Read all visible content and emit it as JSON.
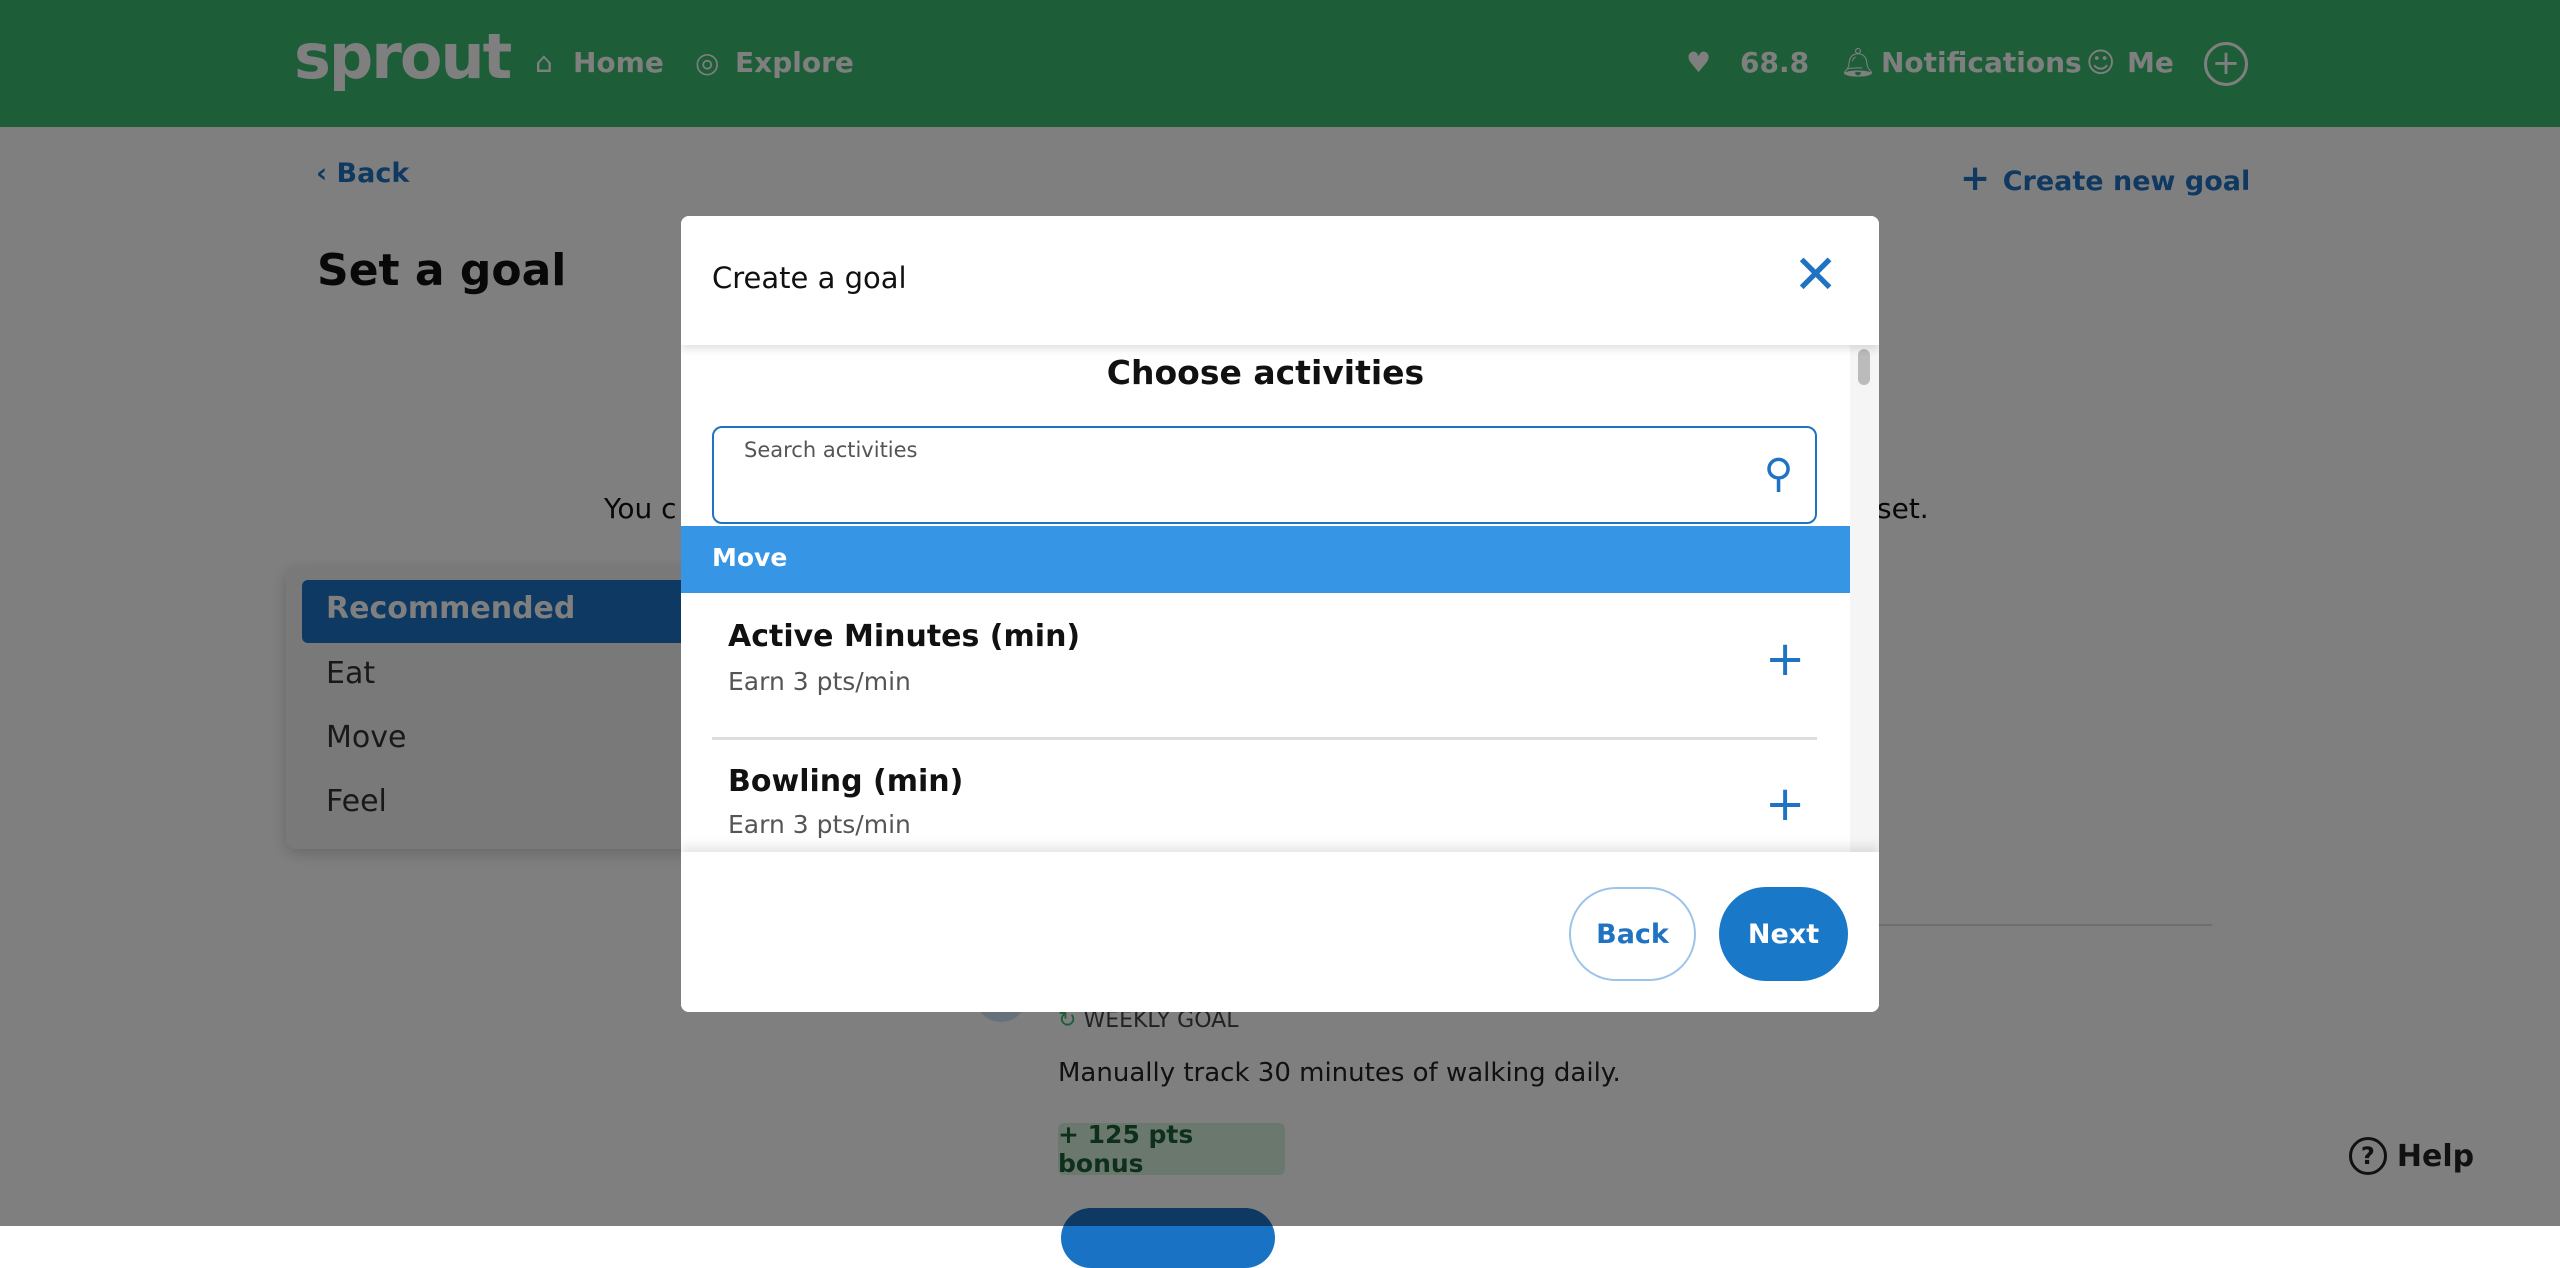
{
  "header": {
    "logo": "sprout",
    "nav": [
      {
        "label": "Home",
        "icon": "home-icon"
      },
      {
        "label": "Explore",
        "icon": "compass-icon"
      }
    ],
    "points": "68.8",
    "notifications": "Notifications",
    "me": "Me"
  },
  "page": {
    "back": "Back",
    "create_new_goal": "Create new goal",
    "title": "Set a goal",
    "intro_left": "You c",
    "intro_right": "set.",
    "categories": [
      "Recommended",
      "Eat",
      "Move",
      "Feel"
    ],
    "selected_category": "Recommended",
    "goal_type": "WEEKLY GOAL",
    "goal_desc": "Manually track 30 minutes of walking daily.",
    "bonus": "+ 125 pts bonus"
  },
  "modal": {
    "title": "Create a goal",
    "heading": "Choose activities",
    "search_label": "Search activities",
    "search_value": "",
    "section": "Move",
    "items": [
      {
        "title": "Active Minutes (min)",
        "sub": "Earn 3 pts/min"
      },
      {
        "title": "Bowling (min)",
        "sub": "Earn 3 pts/min"
      }
    ],
    "back": "Back",
    "next": "Next"
  },
  "help": "Help",
  "colors": {
    "header": "#3abc70",
    "accent": "#1f73c2",
    "section": "#3795e5"
  }
}
